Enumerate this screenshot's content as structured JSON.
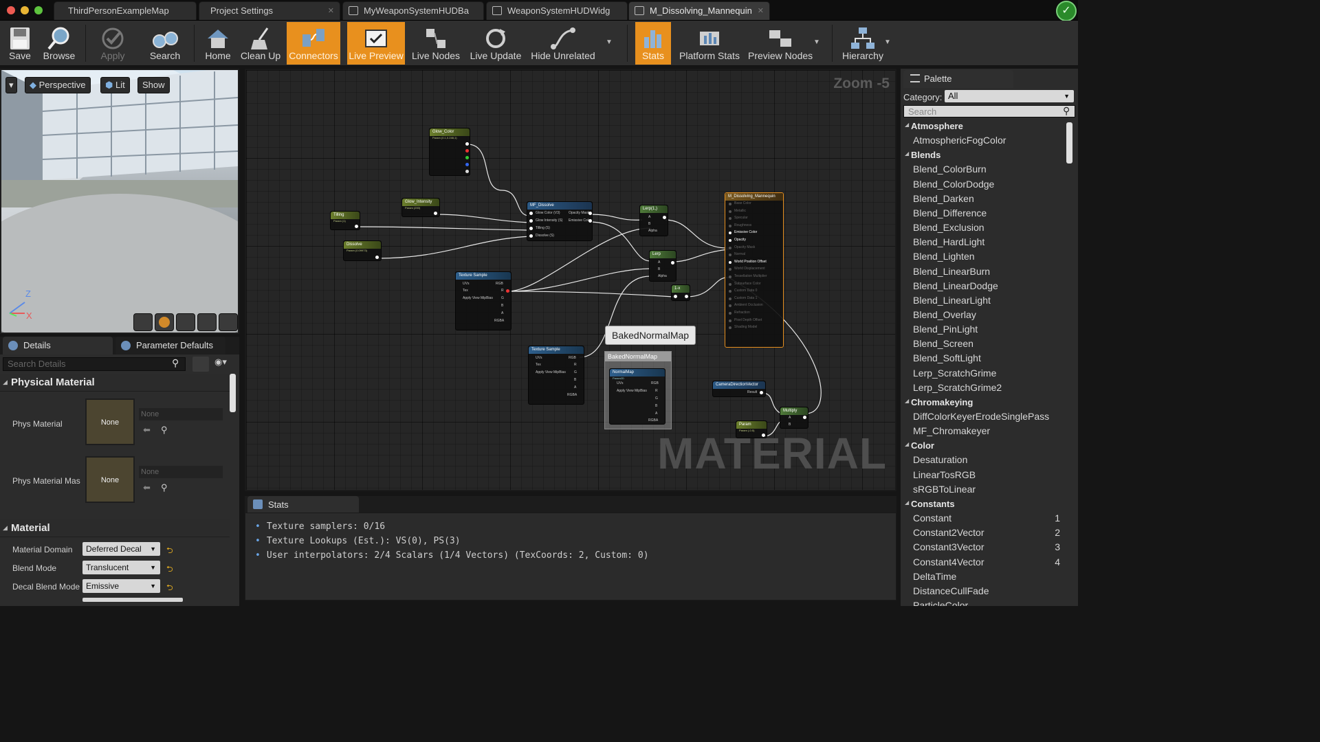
{
  "tabs": [
    {
      "label": "ThirdPersonExampleMap"
    },
    {
      "label": "Project Settings"
    },
    {
      "label": "MyWeaponSystemHUDBa"
    },
    {
      "label": "WeaponSystemHUDWidg"
    },
    {
      "label": "M_Dissolving_Mannequin"
    }
  ],
  "toolbar": {
    "save": "Save",
    "browse": "Browse",
    "apply": "Apply",
    "search": "Search",
    "home": "Home",
    "cleanup": "Clean Up",
    "connectors": "Connectors",
    "live_preview": "Live Preview",
    "live_nodes": "Live Nodes",
    "live_update": "Live Update",
    "hide_unrelated": "Hide Unrelated",
    "stats": "Stats",
    "platform_stats": "Platform Stats",
    "preview_nodes": "Preview Nodes",
    "hierarchy": "Hierarchy"
  },
  "viewport": {
    "perspective": "Perspective",
    "lit": "Lit",
    "show": "Show",
    "axis_z": "Z",
    "axis_x": "X"
  },
  "details": {
    "tab_details": "Details",
    "tab_params": "Parameter Defaults",
    "search_placeholder": "Search Details",
    "physical_material_header": "Physical Material",
    "phys_material_label": "Phys Material",
    "phys_material_mask_label": "Phys Material Mas",
    "none": "None",
    "material_header": "Material",
    "material_domain_label": "Material Domain",
    "material_domain_value": "Deferred Decal",
    "blend_mode_label": "Blend Mode",
    "blend_mode_value": "Translucent",
    "decal_blend_label": "Decal Blend Mode",
    "decal_blend_value": "Emissive"
  },
  "graph": {
    "zoom": "Zoom -5",
    "watermark": "MATERIAL",
    "tooltip": "BakedNormalMap",
    "nodes": {
      "glow_color": {
        "title": "Glow_Color",
        "sub": "Param (0.1,0.248,1)"
      },
      "glow_intensity": {
        "title": "Glow_Intensity",
        "sub": "Param (200)"
      },
      "tilling": {
        "title": "Tilling",
        "sub": "Param (1)"
      },
      "dissolve": {
        "title": "Dissolve",
        "sub": "Param (0.09973)"
      },
      "mf_dissolve": {
        "title": "MF_Dissolve",
        "in1": "Glow Color (V3)",
        "in2": "Glow Intensity (S)",
        "in3": "Tilling (S)",
        "in4": "Dissolve (S)",
        "out1": "Opacity Mask",
        "out2": "Emissive Color"
      },
      "lerp1": {
        "title": "Lerp(1,)",
        "a": "A",
        "b": "B",
        "alpha": "Alpha"
      },
      "lerp2": {
        "title": "Lerp",
        "a": "A",
        "b": "B",
        "alpha": "Alpha"
      },
      "tex1": {
        "title": "Texture Sample",
        "uvs": "UVs",
        "tex": "Tex",
        "mip": "Apply View MipBias",
        "rgb": "RGB",
        "r": "R",
        "g": "G",
        "b": "B",
        "a": "A",
        "rgba": "RGBA"
      },
      "one_minus": {
        "title": "1-x"
      },
      "tex2": {
        "title": "Texture Sample",
        "uvs": "UVs",
        "tex": "Tex",
        "mip": "Apply View MipBias",
        "rgb": "RGB",
        "r": "R",
        "g": "G",
        "b": "B",
        "a": "A",
        "rgba": "RGBA"
      },
      "baked_comment": {
        "title": "BakedNormalMap"
      },
      "normal_map": {
        "title": "NormalMap",
        "sub": "Param2D",
        "uvs": "UVs",
        "mip": "Apply View MipBias",
        "rgb": "RGB",
        "r": "R",
        "g": "G",
        "b": "B",
        "a": "A",
        "rgba": "RGBA"
      },
      "camera": {
        "title": "CameraDirectionVector",
        "result": "Result"
      },
      "param": {
        "title": "Param",
        "sub": "Param (-0.5)"
      },
      "multiply": {
        "title": "Multiply",
        "a": "A",
        "b": "B"
      },
      "result": {
        "title": "M_Dissolving_Mannequin",
        "inputs": [
          "Base Color",
          "Metallic",
          "Specular",
          "Roughness",
          "Emissive Color",
          "Opacity",
          "Opacity Mask",
          "Normal",
          "World Position Offset",
          "World Displacement",
          "Tessellation Multiplier",
          "Subsurface Color",
          "Custom Data 0",
          "Custom Data 1",
          "Ambient Occlusion",
          "Refraction",
          "Pixel Depth Offset",
          "Shading Model"
        ]
      }
    }
  },
  "stats": {
    "tab": "Stats",
    "lines": [
      "Texture samplers: 0/16",
      "Texture Lookups (Est.): VS(0), PS(3)",
      "User interpolators: 2/4 Scalars (1/4 Vectors) (TexCoords: 2, Custom: 0)"
    ]
  },
  "palette": {
    "title": "Palette",
    "category_label": "Category:",
    "category_value": "All",
    "search_placeholder": "Search",
    "entries": [
      {
        "kind": "cat",
        "label": "Atmosphere"
      },
      {
        "kind": "item",
        "label": "AtmosphericFogColor"
      },
      {
        "kind": "cat",
        "label": "Blends"
      },
      {
        "kind": "item",
        "label": "Blend_ColorBurn"
      },
      {
        "kind": "item",
        "label": "Blend_ColorDodge"
      },
      {
        "kind": "item",
        "label": "Blend_Darken"
      },
      {
        "kind": "item",
        "label": "Blend_Difference"
      },
      {
        "kind": "item",
        "label": "Blend_Exclusion"
      },
      {
        "kind": "item",
        "label": "Blend_HardLight"
      },
      {
        "kind": "item",
        "label": "Blend_Lighten"
      },
      {
        "kind": "item",
        "label": "Blend_LinearBurn"
      },
      {
        "kind": "item",
        "label": "Blend_LinearDodge"
      },
      {
        "kind": "item",
        "label": "Blend_LinearLight"
      },
      {
        "kind": "item",
        "label": "Blend_Overlay"
      },
      {
        "kind": "item",
        "label": "Blend_PinLight"
      },
      {
        "kind": "item",
        "label": "Blend_Screen"
      },
      {
        "kind": "item",
        "label": "Blend_SoftLight"
      },
      {
        "kind": "item",
        "label": "Lerp_ScratchGrime"
      },
      {
        "kind": "item",
        "label": "Lerp_ScratchGrime2"
      },
      {
        "kind": "cat",
        "label": "Chromakeying"
      },
      {
        "kind": "item",
        "label": "DiffColorKeyerErodeSinglePass"
      },
      {
        "kind": "item",
        "label": "MF_Chromakeyer"
      },
      {
        "kind": "cat",
        "label": "Color"
      },
      {
        "kind": "item",
        "label": "Desaturation"
      },
      {
        "kind": "item",
        "label": "LinearTosRGB"
      },
      {
        "kind": "item",
        "label": "sRGBToLinear"
      },
      {
        "kind": "cat",
        "label": "Constants"
      },
      {
        "kind": "item",
        "label": "Constant",
        "hotkey": "1"
      },
      {
        "kind": "item",
        "label": "Constant2Vector",
        "hotkey": "2"
      },
      {
        "kind": "item",
        "label": "Constant3Vector",
        "hotkey": "3"
      },
      {
        "kind": "item",
        "label": "Constant4Vector",
        "hotkey": "4"
      },
      {
        "kind": "item",
        "label": "DeltaTime"
      },
      {
        "kind": "item",
        "label": "DistanceCullFade"
      },
      {
        "kind": "item",
        "label": "ParticleColor"
      }
    ]
  },
  "colors": {
    "accent": "#e8901e",
    "editor_bg": "#262626",
    "panel_bg": "#2c2c2c"
  }
}
